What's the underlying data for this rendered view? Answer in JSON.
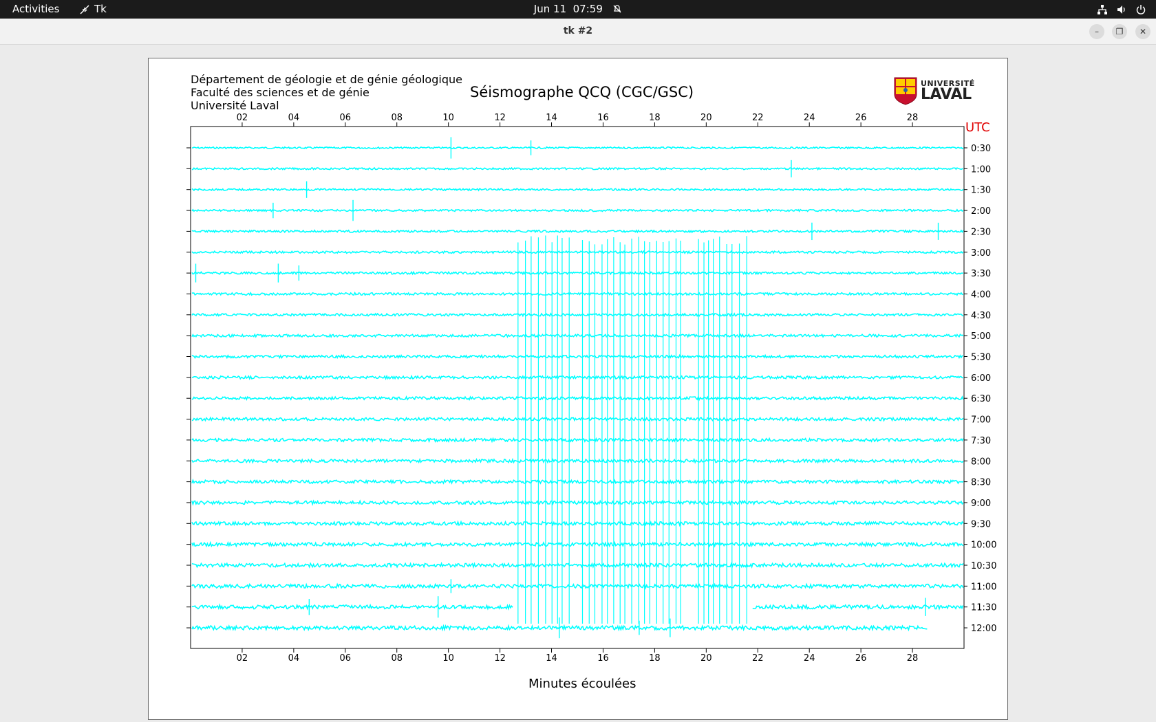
{
  "topbar": {
    "activities": "Activities",
    "app_name": "Tk",
    "date": "Jun 11",
    "time": "07:59"
  },
  "window": {
    "title": "tk #2"
  },
  "header": {
    "dept_line1": "Département de géologie et de génie géologique",
    "dept_line2": "Faculté des sciences et de génie",
    "dept_line3": "Université Laval",
    "title": "Séismographe QCQ (CGC/GSC)",
    "utc_label": "UTC",
    "logo_univ": "UNIVERSITÉ",
    "logo_laval": "LAVAL"
  },
  "colors": {
    "trace": "#00ffff",
    "utc": "#e00000"
  },
  "chart_data": {
    "type": "line",
    "title": "Séismographe QCQ (CGC/GSC)",
    "xlabel": "Minutes écoulées",
    "ylabel": "UTC",
    "xlim": [
      0,
      30
    ],
    "x_ticks": [
      "02",
      "04",
      "06",
      "08",
      "10",
      "12",
      "14",
      "16",
      "18",
      "20",
      "22",
      "24",
      "26",
      "28"
    ],
    "rows": [
      "0:30",
      "1:00",
      "1:30",
      "2:00",
      "2:30",
      "3:00",
      "3:30",
      "4:00",
      "4:30",
      "5:00",
      "5:30",
      "6:00",
      "6:30",
      "7:00",
      "7:30",
      "8:00",
      "8:30",
      "9:00",
      "9:30",
      "10:00",
      "10:30",
      "11:00",
      "11:30",
      "12:00"
    ],
    "spikes": [
      {
        "row": "0:30",
        "minutes": [
          10.1,
          13.2
        ]
      },
      {
        "row": "1:00",
        "minutes": [
          23.3
        ]
      },
      {
        "row": "1:30",
        "minutes": [
          4.5
        ]
      },
      {
        "row": "2:00",
        "minutes": [
          3.2,
          6.3
        ]
      },
      {
        "row": "2:30",
        "minutes": [
          24.1,
          29.0
        ]
      },
      {
        "row": "3:30",
        "minutes": [
          0.2,
          3.4,
          4.2
        ]
      },
      {
        "row": "11:00",
        "minutes": [
          10.1
        ]
      },
      {
        "row": "11:30",
        "minutes": [
          4.6,
          9.6,
          28.5
        ]
      },
      {
        "row": "12:00",
        "minutes": [
          14.3,
          17.4,
          18.6
        ]
      }
    ],
    "burst": {
      "start_minute": 12.7,
      "end_minute": 21.7,
      "from_row": "3:00",
      "to_row": "12:00"
    },
    "last_row_end_minute": 28.6,
    "gap_row": "11:30",
    "gap_minutes": [
      12.5,
      21.8
    ]
  }
}
